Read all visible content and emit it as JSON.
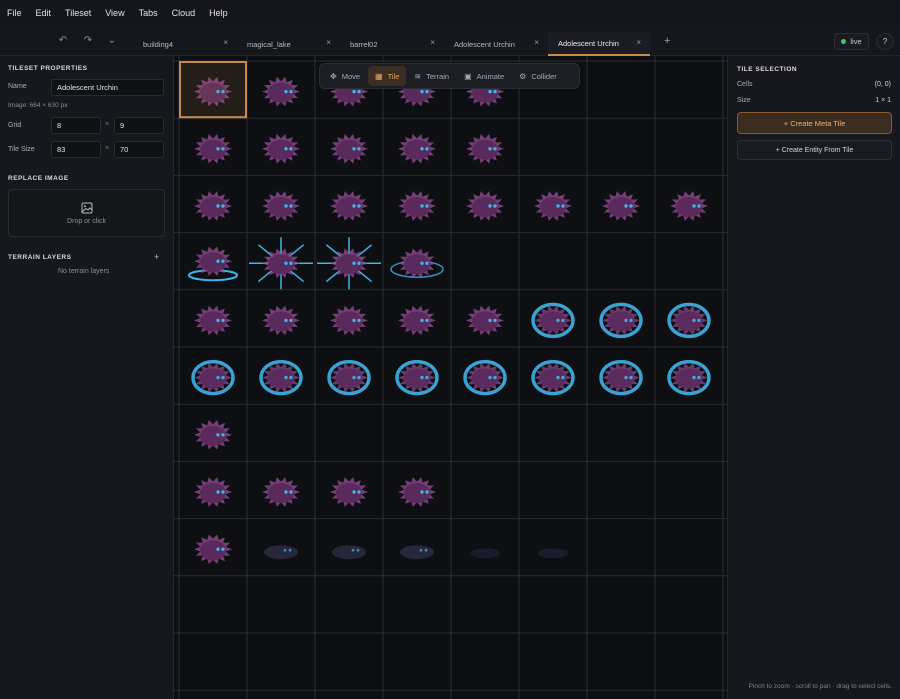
{
  "menu": [
    "File",
    "Edit",
    "Tileset",
    "View",
    "Tabs",
    "Cloud",
    "Help"
  ],
  "tabs": [
    {
      "label": "building4",
      "active": false
    },
    {
      "label": "magical_lake",
      "active": false
    },
    {
      "label": "barrel02",
      "active": false
    },
    {
      "label": "Adolescent Urchin",
      "active": false
    },
    {
      "label": "Adolescent Urchin",
      "active": true
    }
  ],
  "tab_close_glyph": "×",
  "tab_add_glyph": "+",
  "status": {
    "live_label": "live",
    "help_label": "?"
  },
  "tileset_properties": {
    "title": "TILESET PROPERTIES",
    "name_label": "Name",
    "name_value": "Adolescent Urchin",
    "image_info": "Image: 664 × 630 px",
    "grid_label": "Grid",
    "grid_cols": "8",
    "grid_rows": "9",
    "tile_size_label": "Tile Size",
    "tile_w": "83",
    "tile_h": "70",
    "times": "×"
  },
  "replace_image": {
    "title": "REPLACE IMAGE",
    "drop_text": "Drop or click"
  },
  "terrain_layers": {
    "title": "TERRAIN LAYERS",
    "add_glyph": "+",
    "empty_text": "No terrain layers"
  },
  "mode_toolbar": [
    {
      "label": "Move",
      "icon": "move-icon",
      "active": false
    },
    {
      "label": "Tile",
      "icon": "grid-icon",
      "active": true
    },
    {
      "label": "Terrain",
      "icon": "layers-icon",
      "active": false
    },
    {
      "label": "Animate",
      "icon": "image-icon",
      "active": false
    },
    {
      "label": "Collider",
      "icon": "gear-icon",
      "active": false
    }
  ],
  "tile_selection": {
    "title": "TILE SELECTION",
    "cells_label": "Cells",
    "cells_value": "(0, 0)",
    "size_label": "Size",
    "size_value": "1 × 1",
    "create_meta_tile": "+ Create Meta Tile",
    "create_entity": "+ Create Entity From Tile"
  },
  "hint": "Pinch to zoom · scroll to pan · drag to select cells.",
  "tileset_grid": {
    "cols": 8,
    "rows": 9,
    "selected_cell": [
      0,
      0
    ],
    "sprite_types": [
      [
        "urchin",
        "urchin",
        "urchin",
        "urchin",
        "urchin",
        "empty",
        "empty",
        "empty"
      ],
      [
        "urchin",
        "urchin",
        "urchin",
        "urchin",
        "urchin",
        "empty",
        "empty",
        "empty"
      ],
      [
        "urchin",
        "urchin",
        "urchin",
        "urchin",
        "urchin",
        "urchin",
        "urchin",
        "urchin"
      ],
      [
        "splash",
        "spike",
        "spike",
        "ring",
        "empty",
        "empty",
        "empty",
        "empty"
      ],
      [
        "urchin",
        "urchin",
        "urchin",
        "urchin",
        "urchin",
        "swirl",
        "swirl",
        "swirl"
      ],
      [
        "swirl",
        "swirl",
        "swirl",
        "swirl",
        "swirl",
        "swirl",
        "swirl",
        "swirl"
      ],
      [
        "urchin",
        "empty",
        "empty",
        "empty",
        "empty",
        "empty",
        "empty",
        "empty"
      ],
      [
        "urchin",
        "urchin",
        "urchin",
        "urchin",
        "empty",
        "empty",
        "empty",
        "empty"
      ],
      [
        "urchin",
        "ghost",
        "ghost",
        "ghost",
        "faint",
        "faint",
        "empty",
        "empty"
      ]
    ]
  },
  "colors": {
    "accent": "#c9894a",
    "urchin_body": "#5a2a5c",
    "urchin_spike": "#9a4f99",
    "glow": "#3fb4e8",
    "live": "#46c46a"
  }
}
